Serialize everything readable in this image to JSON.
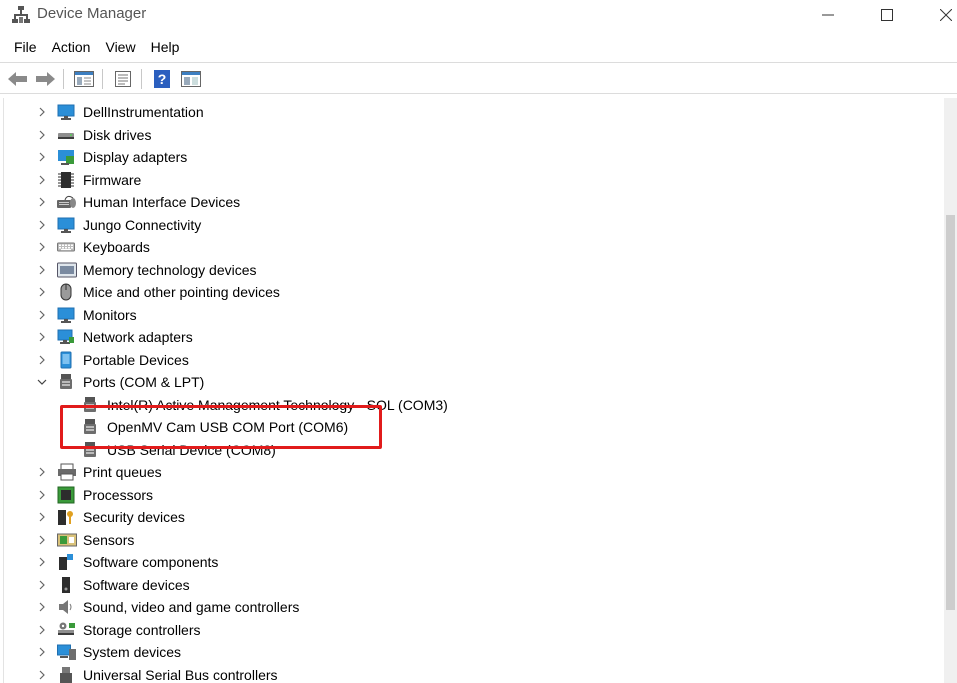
{
  "window": {
    "title": "Device Manager",
    "icon": "device-manager-icon"
  },
  "menu": {
    "items": [
      "File",
      "Action",
      "View",
      "Help"
    ]
  },
  "toolbar": {
    "buttons": [
      "back-arrow-icon",
      "forward-arrow-icon",
      "show-hide-tree-icon",
      "properties-icon",
      "help-icon",
      "update-view-icon"
    ]
  },
  "tree": {
    "items": [
      {
        "label": "DellInstrumentation",
        "icon": "monitor-icon",
        "expanded": false
      },
      {
        "label": "Disk drives",
        "icon": "disk-drive-icon",
        "expanded": false
      },
      {
        "label": "Display adapters",
        "icon": "display-adapter-icon",
        "expanded": false
      },
      {
        "label": "Firmware",
        "icon": "firmware-chip-icon",
        "expanded": false
      },
      {
        "label": "Human Interface Devices",
        "icon": "hid-icon",
        "expanded": false
      },
      {
        "label": "Jungo Connectivity",
        "icon": "monitor-icon",
        "expanded": false
      },
      {
        "label": "Keyboards",
        "icon": "keyboard-icon",
        "expanded": false
      },
      {
        "label": "Memory technology devices",
        "icon": "memory-card-icon",
        "expanded": false
      },
      {
        "label": "Mice and other pointing devices",
        "icon": "mouse-icon",
        "expanded": false
      },
      {
        "label": "Monitors",
        "icon": "monitor-icon",
        "expanded": false
      },
      {
        "label": "Network adapters",
        "icon": "network-adapter-icon",
        "expanded": false
      },
      {
        "label": "Portable Devices",
        "icon": "portable-device-icon",
        "expanded": false
      },
      {
        "label": "Ports (COM & LPT)",
        "icon": "port-connector-icon",
        "expanded": true
      },
      {
        "label": "Intel(R) Active Management Technology - SOL (COM3)",
        "icon": "port-connector-icon",
        "child": true
      },
      {
        "label": "OpenMV Cam USB COM Port (COM6)",
        "icon": "port-connector-icon",
        "child": true
      },
      {
        "label": "USB Serial Device (COM8)",
        "icon": "port-connector-icon",
        "child": true
      },
      {
        "label": "Print queues",
        "icon": "printer-icon",
        "expanded": false
      },
      {
        "label": "Processors",
        "icon": "processor-icon",
        "expanded": false
      },
      {
        "label": "Security devices",
        "icon": "security-key-icon",
        "expanded": false
      },
      {
        "label": "Sensors",
        "icon": "sensor-icon",
        "expanded": false
      },
      {
        "label": "Software components",
        "icon": "software-component-icon",
        "expanded": false
      },
      {
        "label": "Software devices",
        "icon": "software-device-icon",
        "expanded": false
      },
      {
        "label": "Sound, video and game controllers",
        "icon": "speaker-icon",
        "expanded": false
      },
      {
        "label": "Storage controllers",
        "icon": "storage-controller-icon",
        "expanded": false
      },
      {
        "label": "System devices",
        "icon": "system-device-icon",
        "expanded": false
      },
      {
        "label": "Universal Serial Bus controllers",
        "icon": "usb-controller-icon",
        "expanded": false
      }
    ]
  },
  "annotation": {
    "highlight_color": "#e11b1b"
  },
  "colors": {
    "icon_blue": "#2b8fd8",
    "icon_dark": "#3c3c3c"
  }
}
